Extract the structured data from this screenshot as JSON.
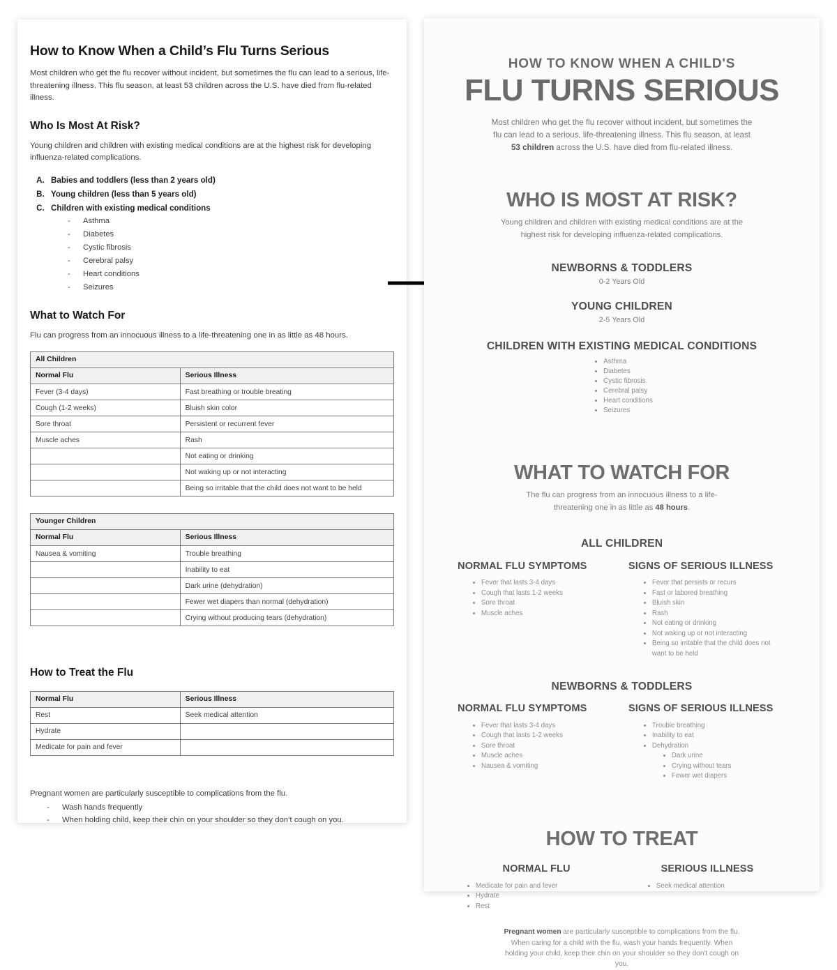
{
  "document": {
    "title": "How to Know When a Child’s Flu Turns Serious",
    "intro": "Most children who get the flu recover without incident, but sometimes the flu can lead to a serious, life-threatening illness. This flu season, at least 53 children across the U.S. have died from flu-related illness.",
    "risk_heading": "Who Is Most At Risk?",
    "risk_intro": "Young children and children with existing medical conditions are at the highest risk for developing influenza-related complications.",
    "risk_items": [
      "Babies and toddlers (less than 2 years old)",
      "Young children (less than 5 years old)",
      "Children with existing medical conditions"
    ],
    "conditions": [
      "Asthma",
      "Diabetes",
      "Cystic fibrosis",
      "Cerebral palsy",
      "Heart conditions",
      "Seizures"
    ],
    "watch_heading": "What to Watch For",
    "watch_intro": "Flu can progress from an innocuous illness to a life-threatening one in as little as 48 hours.",
    "table_all_children": {
      "caption": "All Children",
      "headers": [
        "Normal Flu",
        "Serious Illness"
      ],
      "rows": [
        [
          "Fever (3-4 days)",
          "Fast breathing or trouble breating"
        ],
        [
          "Cough (1-2 weeks)",
          "Bluish skin color"
        ],
        [
          "Sore throat",
          "Persistent or recurrent fever"
        ],
        [
          "Muscle aches",
          "Rash"
        ],
        [
          "",
          "Not eating or drinking"
        ],
        [
          "",
          "Not waking up or not interacting"
        ],
        [
          "",
          "Being so irritable that the child does not want to be held"
        ]
      ]
    },
    "table_younger_children": {
      "caption": "Younger Children",
      "headers": [
        "Normal Flu",
        "Serious Illness"
      ],
      "rows": [
        [
          "Nausea & vomiting",
          "Trouble breathing"
        ],
        [
          "",
          "Inability to eat"
        ],
        [
          "",
          "Dark urine (dehydration)"
        ],
        [
          "",
          "Fewer wet diapers than normal (dehydration)"
        ],
        [
          "",
          "Crying without producing tears (dehydration)"
        ]
      ]
    },
    "treat_heading": "How to Treat the Flu",
    "table_treat": {
      "headers": [
        "Normal Flu",
        "Serious Illness"
      ],
      "rows": [
        [
          "Rest",
          "Seek medical attention"
        ],
        [
          "Hydrate",
          ""
        ],
        [
          "Medicate for pain and fever",
          ""
        ]
      ]
    },
    "footer_intro": "Pregnant women are particularly susceptible to complications from the flu.",
    "footer_items": [
      "Wash hands frequently",
      "When holding child, keep their chin on your shoulder so they don’t cough on you."
    ]
  },
  "infographic": {
    "kicker": "HOW TO KNOW WHEN A CHILD'S",
    "title": "FLU TURNS SERIOUS",
    "lede_part1": "Most children who get the flu recover without incident, but sometimes the flu can lead to a serious, life-threatening illness. This flu season, at least ",
    "lede_bold": "53 children",
    "lede_part2": " across the U.S. have died from flu-related illness.",
    "risk": {
      "heading": "WHO IS MOST AT RISK?",
      "sub": "Young children and children with existing medical conditions are at the highest risk for developing influenza-related complications.",
      "group1_head": "NEWBORNS & TODDLERS",
      "group1_sub": "0-2 Years Old",
      "group2_head": "YOUNG CHILDREN",
      "group2_sub": "2-5 Years Old",
      "group3_head": "CHILDREN WITH EXISTING MEDICAL CONDITIONS",
      "group3_items": [
        "Asthma",
        "Diabetes",
        "Cystic fibrosis",
        "Cerebral palsy",
        "Heart conditions",
        "Seizures"
      ]
    },
    "watch": {
      "heading": "WHAT TO WATCH FOR",
      "sub_part1": "The flu can progress from an innocuous illness to a life-threatening one in as little as ",
      "sub_bold": "48 hours",
      "sub_part2": ".",
      "all_children_head": "ALL CHILDREN",
      "all_children_normal_head": "NORMAL FLU SYMPTOMS",
      "all_children_normal": [
        "Fever that lasts 3-4 days",
        "Cough that lasts 1-2 weeks",
        "Sore throat",
        "Muscle aches"
      ],
      "all_children_serious_head": "SIGNS OF SERIOUS ILLNESS",
      "all_children_serious": [
        "Fever that persists or recurs",
        "Fast or labored breathing",
        "Bluish skin",
        "Rash",
        "Not eating or drinking",
        "Not waking up or not interacting",
        "Being so irritable that the child does not want to be held"
      ],
      "newborns_head": "NEWBORNS & TODDLERS",
      "newborns_normal_head": "NORMAL FLU SYMPTOMS",
      "newborns_normal": [
        "Fever that lasts 3-4 days",
        "Cough that lasts 1-2 weeks",
        "Sore throat",
        "Muscle aches",
        "Nausea & vomiting"
      ],
      "newborns_serious_head": "SIGNS OF SERIOUS ILLNESS",
      "newborns_serious": [
        "Trouble breathing",
        "Inability to eat",
        "Dehydration"
      ],
      "newborns_serious_sub": [
        "Dark urine",
        "Crying without tears",
        "Fewer wet diapers"
      ]
    },
    "treat": {
      "heading": "HOW TO TREAT",
      "normal_head": "NORMAL FLU",
      "normal_items": [
        "Medicate for pain and fever",
        "Hydrate",
        "Rest"
      ],
      "serious_head": "SERIOUS ILLNESS",
      "serious_items": [
        "Seek medical attention"
      ],
      "footnote_bold": "Pregnant women",
      "footnote_rest": " are particularly susceptible to complications from the flu. When caring for a child with the flu, wash your hands frequently. When holding your child, keep their chin on your shoulder so they don't cough on you."
    }
  },
  "colors": {
    "panel_bg": "#ffffff",
    "infographic_bg": "#fcfcff",
    "heading_gray": "#6a6a6a",
    "body_gray": "#8a8a8a",
    "table_header_bg": "#f0f0f0",
    "table_border": "#777777"
  }
}
